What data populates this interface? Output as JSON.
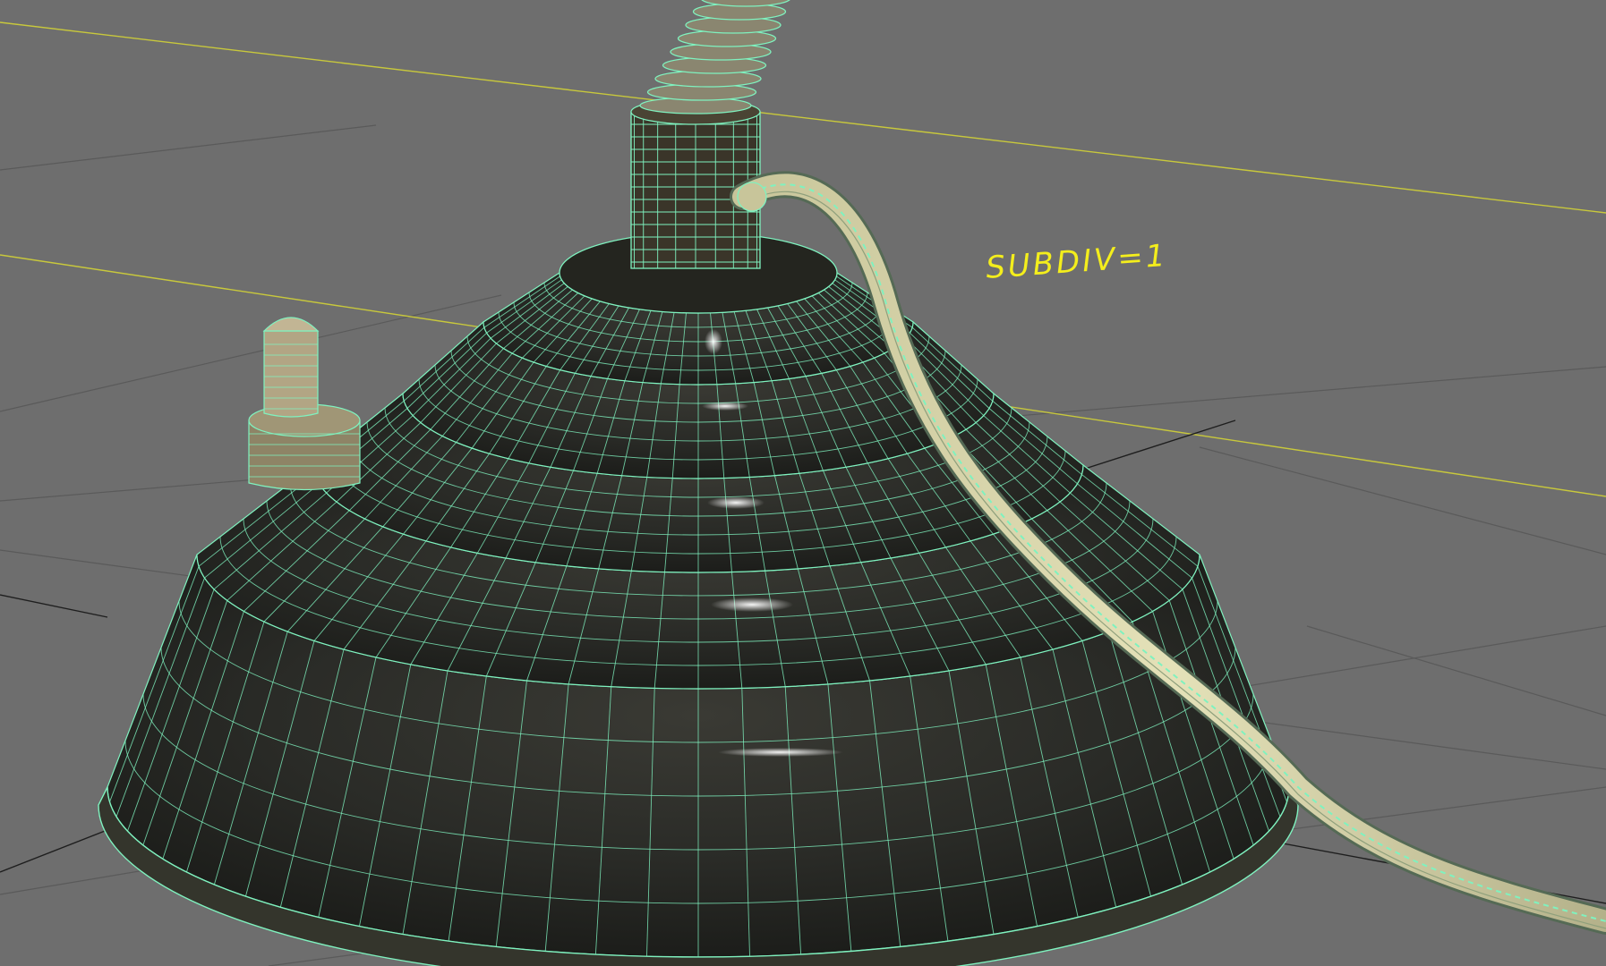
{
  "viewport": {
    "annotation": "SUBDIV=1",
    "background": "#6e6e6e",
    "grid_line_color": "#5c5c5c",
    "axis_line_color": "#c9c93a",
    "wire_color": "#7ff2bf",
    "cord_color": "#d8d4a8",
    "surface_color": "#2b2c28",
    "icons": [
      "lamp-base-mesh",
      "lamp-neck-mesh",
      "power-cord-mesh",
      "switch-knob-mesh"
    ]
  }
}
